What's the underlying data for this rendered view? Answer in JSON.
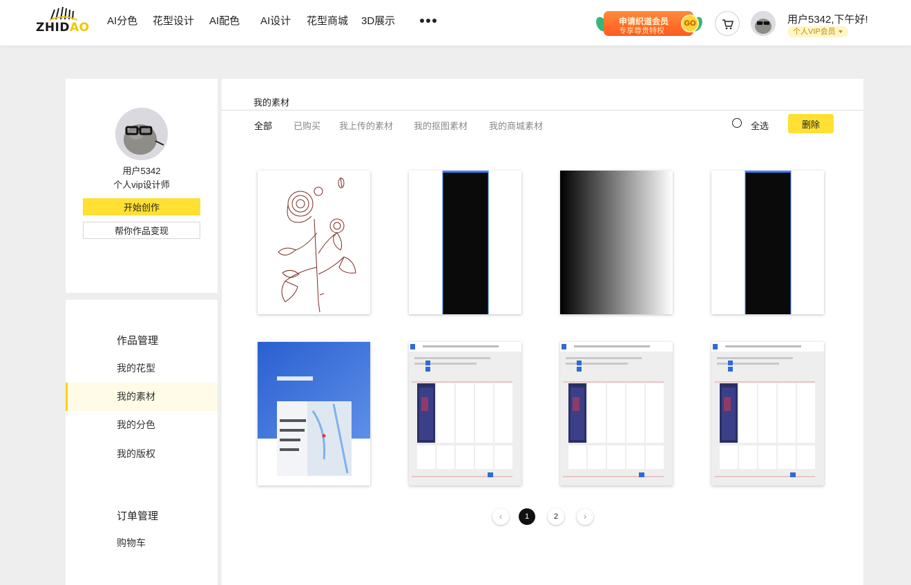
{
  "brand": {
    "logo_text_a": "ZHID",
    "logo_text_b": "AO"
  },
  "nav": {
    "items": [
      "AI分色",
      "花型设计",
      "AI配色",
      "AI设计",
      "花型商城",
      "3D展示"
    ],
    "more_icon": "more-dots-icon"
  },
  "vip_banner": {
    "line1": "申请织道会员",
    "line2": "专享尊贵特权",
    "go": "GO"
  },
  "user": {
    "greeting": "用户5342,下午好!",
    "vip_tag": "个人VIP会员",
    "name": "用户5342",
    "role": "个人vip设计师"
  },
  "profile": {
    "create_button": "开始创作",
    "monetize_button": "帮你作品变现"
  },
  "menu": {
    "group_works": "作品管理",
    "items": [
      "我的花型",
      "我的素材",
      "我的分色",
      "我的版权"
    ],
    "active_index": 1,
    "group_orders": "订单管理",
    "order_items": [
      "购物车"
    ]
  },
  "main": {
    "title": "我的素材",
    "tabs": [
      "全部",
      "已购买",
      "我上传的素材",
      "我的抠图素材",
      "我的商城素材"
    ],
    "active_tab": 0,
    "select_all": "全选",
    "delete_button": "删除"
  },
  "materials": [
    {
      "kind": "rose-sketch"
    },
    {
      "kind": "black-stripe"
    },
    {
      "kind": "gradient"
    },
    {
      "kind": "black-stripe"
    },
    {
      "kind": "blue-screenshot"
    },
    {
      "kind": "editor-screenshot"
    },
    {
      "kind": "editor-screenshot"
    },
    {
      "kind": "editor-screenshot"
    }
  ],
  "pagination": {
    "pages": [
      "1",
      "2"
    ],
    "current": "1",
    "prev_icon": "chevron-left-icon",
    "next_icon": "chevron-right-icon"
  },
  "colors": {
    "accent": "#ffe033",
    "active_menu_bg": "#fffbe6",
    "active_menu_bar": "#ffcf1a"
  }
}
